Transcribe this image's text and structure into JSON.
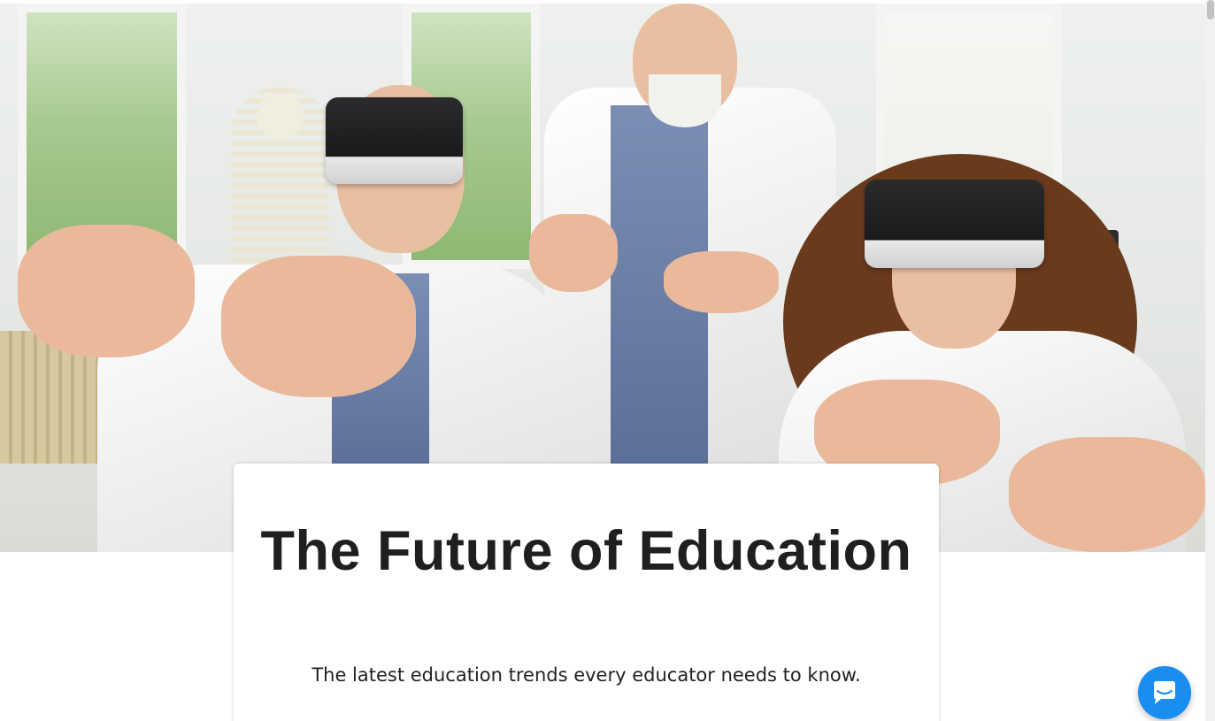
{
  "hero": {
    "image_alt": "Students wearing VR headsets with a teacher in a lab"
  },
  "article": {
    "title": "The Future of Education",
    "subtitle": "The latest education trends every educator needs to know."
  },
  "chat_widget": {
    "icon": "chat-bubble-icon",
    "color": "#1a8ef0"
  },
  "scrollbar": {
    "position": 0
  }
}
